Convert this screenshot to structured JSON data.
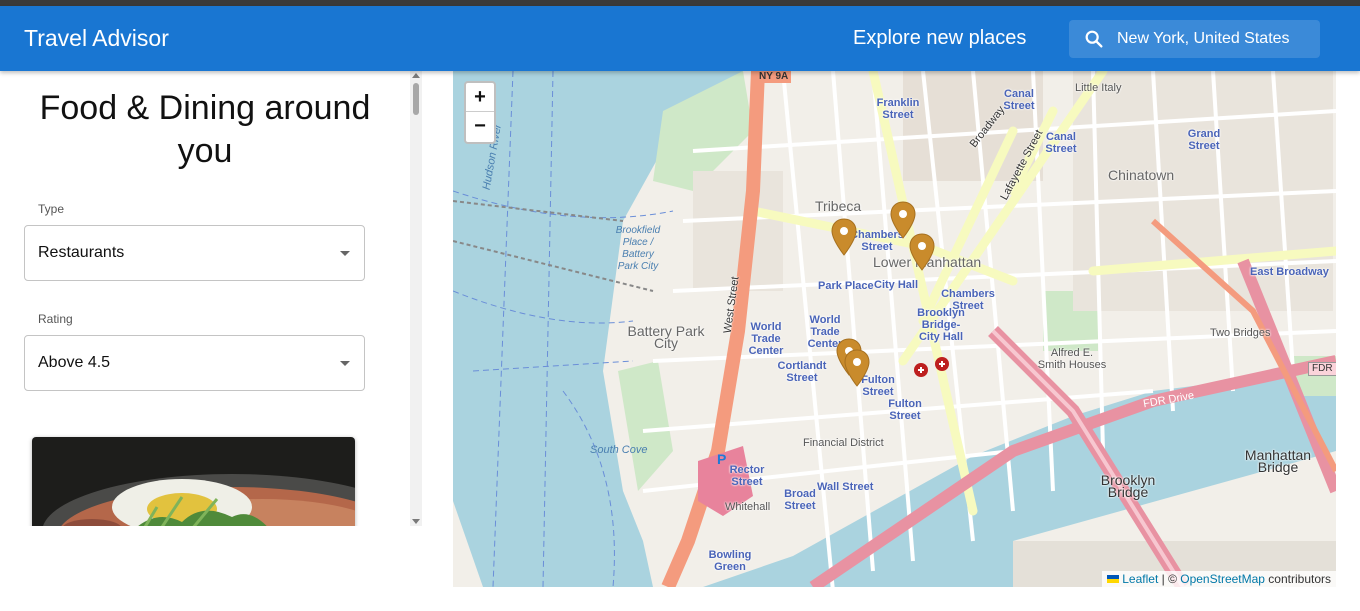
{
  "header": {
    "title": "Travel Advisor",
    "explore_label": "Explore new places",
    "search_value": "New York, United States"
  },
  "sidebar": {
    "heading": "Food & Dining around you",
    "type": {
      "label": "Type",
      "value": "Restaurants"
    },
    "rating": {
      "label": "Rating",
      "value": "Above 4.5"
    }
  },
  "map": {
    "zoom_in": "+",
    "zoom_out": "−",
    "attribution": {
      "leaflet": "Leaflet",
      "separator": " | © ",
      "osm": "OpenStreetMap",
      "contributors": " contributors"
    },
    "labels": {
      "tribeca": "Tribeca",
      "lower_manhattan": "Lower Manhattan",
      "chinatown": "Chinatown",
      "battery_park": "Battery Park City",
      "financial_district": "Financial District",
      "two_bridges": "Two Bridges",
      "south_cove": "South Cove",
      "whitehall": "Whitehall",
      "little_italy": "Little Italy",
      "manhattan_bridge": "Manhattan Bridge",
      "brooklyn_bridge": "Brooklyn Bridge",
      "fdr_drive": "FDR Drive",
      "west_street": "West Street",
      "broadway": "Broadway",
      "lafayette": "Lafayette Street",
      "park_place": "Park Place",
      "city_hall": "City Hall",
      "chambers_street": "Chambers Street",
      "chambers_street_2": "Chambers Street",
      "franklin_street": "Franklin Street",
      "canal_street": "Canal Street",
      "canal_street_2": "Canal Street",
      "grand_street": "Grand Street",
      "east_broadway": "East Broadway",
      "wtc": "World Trade Center",
      "world_trade": "World Trade Center",
      "cortlandt": "Cortlandt Street",
      "fulton_1": "Fulton Street",
      "fulton_2": "Fulton Street",
      "rector": "Rector Street",
      "wall_street": "Wall Street",
      "broad_street": "Broad Street",
      "bowling_green": "Bowling Green",
      "brooklyn_bridge_city_hall": "Brooklyn Bridge-City Hall",
      "hudson_river": "Hudson River",
      "brookfield": "Brookfield Place / Battery Park City",
      "alfred_smith": "Alfred E. Smith Houses",
      "ny9a": "NY 9A",
      "fdr_shield": "FDR"
    }
  },
  "colors": {
    "appbar": "#1976d2",
    "pin": "#c98b2c",
    "water": "#aad3df",
    "land": "#f2efe9"
  }
}
